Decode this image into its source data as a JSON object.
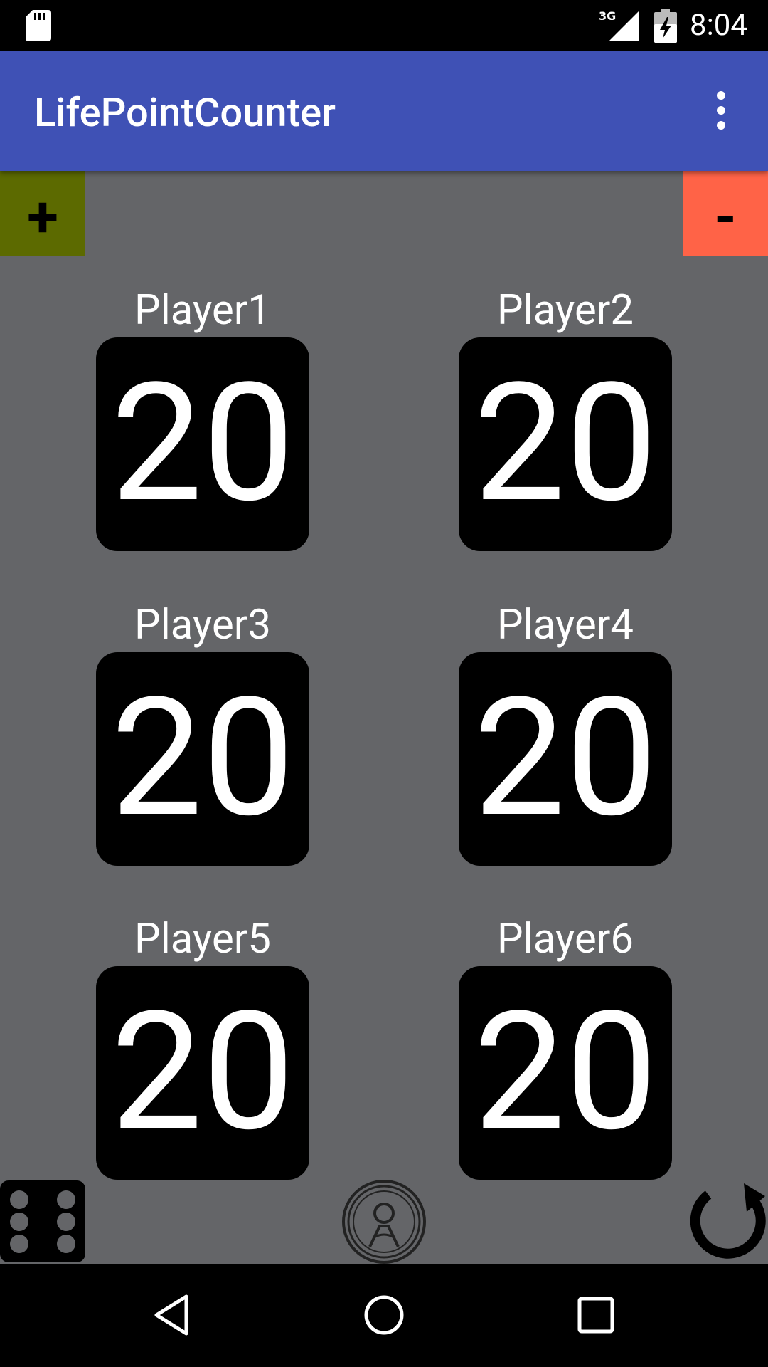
{
  "status_bar": {
    "time": "8:04",
    "network": "3G",
    "icons": [
      "sd-card-icon",
      "signal-icon",
      "battery-icon"
    ]
  },
  "app_bar": {
    "title": "LifePointCounter",
    "menu_icon": "overflow-menu-icon",
    "color": "#3f51b5"
  },
  "controls": {
    "plus_label": "+",
    "minus_label": "-",
    "plus_color": "#5c6a00",
    "minus_color": "#ff6347"
  },
  "players": [
    {
      "name": "Player1",
      "score": "20"
    },
    {
      "name": "Player2",
      "score": "20"
    },
    {
      "name": "Player3",
      "score": "20"
    },
    {
      "name": "Player4",
      "score": "20"
    },
    {
      "name": "Player5",
      "score": "20"
    },
    {
      "name": "Player6",
      "score": "20"
    }
  ],
  "bottom_tools": {
    "dice_icon": "dice-icon",
    "coin_icon": "coin-icon",
    "reset_icon": "reset-icon"
  },
  "nav_bar": {
    "icons": [
      "back-icon",
      "home-icon",
      "recent-apps-icon"
    ]
  },
  "colors": {
    "background": "#646568",
    "score_box": "#000000",
    "text": "#ffffff"
  }
}
